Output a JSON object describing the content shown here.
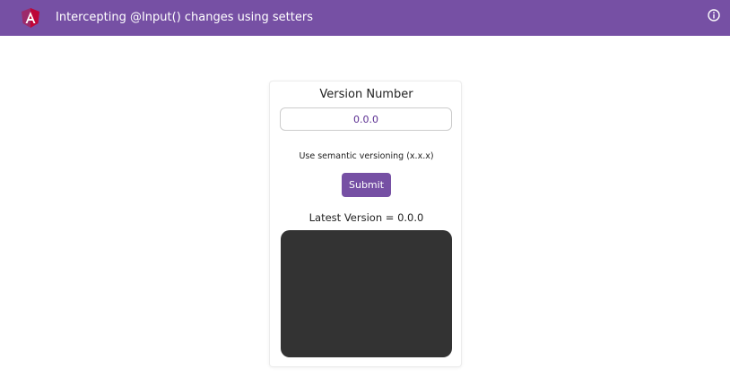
{
  "header": {
    "title": "Intercepting @Input() changes using setters",
    "background_color": "#7650a4",
    "logo_icon": "angular-logo-icon",
    "info_icon": "info-circle-icon"
  },
  "form": {
    "label": "Version Number",
    "input_value": "0.0.0",
    "hint": "Use semantic versioning (x.x.x)",
    "submit_label": "Submit",
    "accent_color": "#7650a4"
  },
  "result": {
    "latest_version_text": "Latest Version = 0.0.0",
    "panel_color": "#333333"
  }
}
